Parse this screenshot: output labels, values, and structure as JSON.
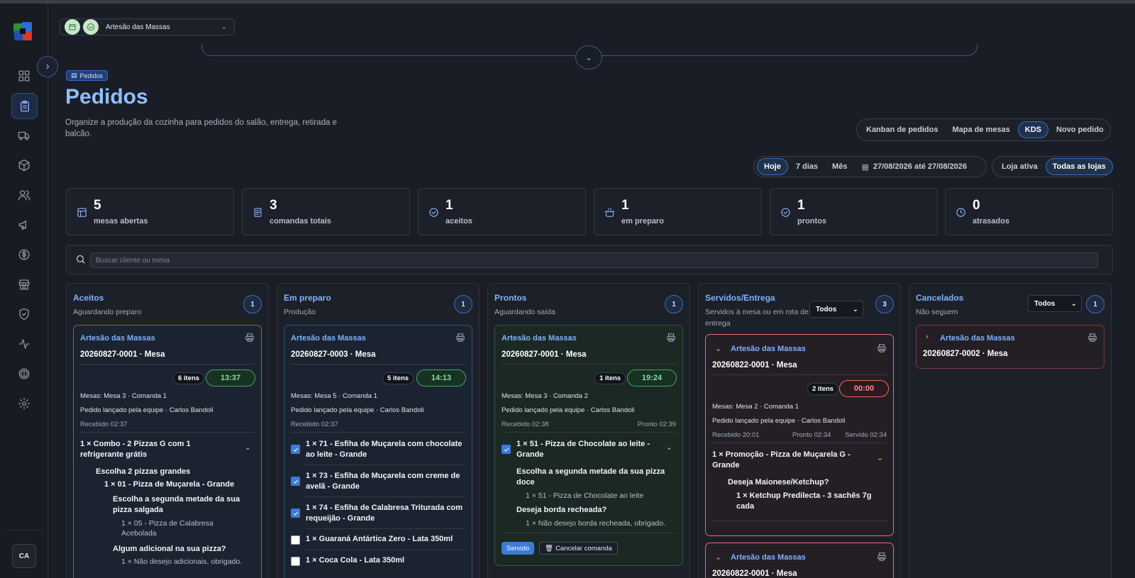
{
  "sidebar": {
    "nav_icons": [
      "grid-icon",
      "clipboard-icon",
      "truck-icon",
      "box-icon",
      "users-icon",
      "megaphone-icon",
      "dollar-icon",
      "store-icon",
      "shield-icon",
      "activity-icon",
      "dollar-circle-icon",
      "gear-icon"
    ],
    "avatar": "CA"
  },
  "header": {
    "store_name": "Artesão das Massas"
  },
  "page": {
    "chip": "Pedidos",
    "title": "Pedidos",
    "description": "Organize a produção da cozinha para pedidos do salão, entrega, retirada e balcão."
  },
  "view_tabs": [
    "Kanban de pedidos",
    "Mapa de mesas",
    "KDS",
    "Novo pedido"
  ],
  "view_tabs_active": "KDS",
  "period_tabs": [
    "Hoje",
    "7 dias",
    "Mês"
  ],
  "date_range": "27/08/2026 até 27/08/2026",
  "store_scope": [
    "Loja ativa",
    "Todas as lojas"
  ],
  "stats": [
    {
      "value": "5",
      "label": "mesas abertas",
      "icon": "table-icon"
    },
    {
      "value": "3",
      "label": "comandas totais",
      "icon": "receipt-icon"
    },
    {
      "value": "1",
      "label": "aceitos",
      "icon": "check-circle-icon"
    },
    {
      "value": "1",
      "label": "em preparo",
      "icon": "cooking-pot-icon"
    },
    {
      "value": "1",
      "label": "prontos",
      "icon": "check-circle-icon"
    },
    {
      "value": "0",
      "label": "atrasados",
      "icon": "clock-icon"
    }
  ],
  "search": {
    "placeholder": "Buscar cliente ou mesa"
  },
  "columns": {
    "aceitos": {
      "title": "Aceitos",
      "subtitle": "Aguardando preparo",
      "count": "1",
      "card": {
        "store": "Artesão das Massas",
        "order": "20260827-0001 · Mesa",
        "items": "6 itens",
        "timer": "13:37",
        "mesas": "Mesas: Mesa 3 · Comanda 1",
        "launched": "Pedido lançado pela equipe · Carlos Bandoli",
        "received": "Recebido 02:37",
        "line1": "1 × Combo - 2 Pizzas G com 1 refrigerante grátis",
        "group1": "Escolha 2 pizzas grandes",
        "item1": "1 × 01 - Pizza de Muçarela - Grande",
        "group2": "Escolha a segunda metade da sua pizza salgada",
        "opt1": "1 × 05 - Pizza de Calabresa Acebolada",
        "group3": "Algum adicional na sua pizza?",
        "opt2": "1 × Não desejo adicionais, obrigado."
      }
    },
    "preparo": {
      "title": "Em preparo",
      "subtitle": "Produção",
      "count": "1",
      "card": {
        "store": "Artesão das Massas",
        "order": "20260827-0003 · Mesa",
        "items": "5 itens",
        "timer": "14:13",
        "mesas": "Mesas: Mesa 5 · Comanda 1",
        "launched": "Pedido lançado pela equipe · Carlos Bandoli",
        "received": "Recebido 02:37",
        "lines": [
          "1 × 71 - Esfiha de Muçarela com chocolate ao leite - Grande",
          "1 × 73 - Esfiha de Muçarela com creme de avelã - Grande",
          "1 × 74 - Esfiha de Calabresa Triturada com requeijão - Grande",
          "1 × Guaraná Antártica Zero - Lata 350ml",
          "1 × Coca Cola - Lata 350ml"
        ]
      }
    },
    "prontos": {
      "title": "Prontos",
      "subtitle": "Aguardando saída",
      "count": "1",
      "card": {
        "store": "Artesão das Massas",
        "order": "20260827-0001 · Mesa",
        "items": "1 itens",
        "timer": "19:24",
        "mesas": "Mesas: Mesa 3 · Comanda 2",
        "launched": "Pedido lançado pela equipe · Carlos Bandoli",
        "received": "Recebido 02:38",
        "ready": "Pronto 02:39",
        "line1": "1 × 51 - Pizza de Chocolate ao leite - Grande",
        "group1": "Escolha a segunda metade da sua pizza doce",
        "opt1": "1 × 51 - Pizza de Chocolate ao leite",
        "group2": "Deseja borda recheada?",
        "opt2": "1 × Não desejo borda recheada, obrigado.",
        "btn_servido": "Servido",
        "btn_cancel": "Cancelar comanda"
      }
    },
    "servidos": {
      "title": "Servidos/Entrega",
      "subtitle": "Servidos à mesa ou em rota de entrega",
      "count": "3",
      "filter": "Todos",
      "card": {
        "store": "Artesão das Massas",
        "order": "20260822-0001 · Mesa",
        "items": "2 itens",
        "timer": "00:00",
        "mesas": "Mesas: Mesa 2 · Comanda 1",
        "launched": "Pedido lançado pela equipe · Carlos Bandoli",
        "received": "Recebido 20:01",
        "ready": "Pronto 02:34",
        "served": "Servido 02:34",
        "line1": "1 × Promoção - Pizza de Muçarela G - Grande",
        "group1": "Deseja Maionese/Ketchup?",
        "item1": "1 × Ketchup Predilecta - 3 sachês 7g cada"
      },
      "card2": {
        "store": "Artesão das Massas",
        "order": "20260822-0001 · Mesa"
      }
    },
    "cancelados": {
      "title": "Cancelados",
      "subtitle": "Não seguem",
      "count": "1",
      "filter": "Todos",
      "card": {
        "store": "Artesão das Massas",
        "order": "20260827-0002 · Mesa"
      }
    }
  },
  "colors": {
    "accent": "#3d7bd8",
    "title_blue": "#8ec0ff",
    "ok_green": "#4ea26a",
    "alert_red": "#e96b6b",
    "warn_orange": "#8a6a3a"
  }
}
